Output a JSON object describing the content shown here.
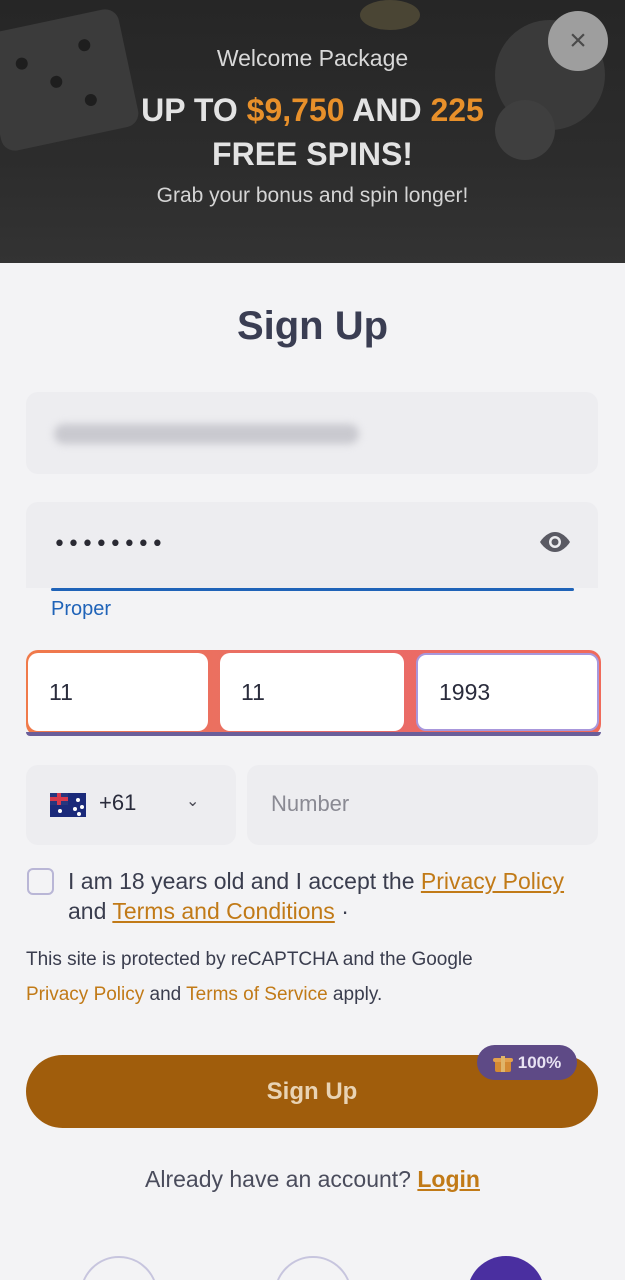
{
  "banner": {
    "welcome": "Welcome Package",
    "headline_prefix": "UP TO ",
    "headline_amount": "$9,750",
    "headline_and": " AND ",
    "headline_spins_count": "225",
    "headline_suffix": "FREE SPINS!",
    "subline": "Grab your bonus and spin longer!",
    "close_label": "×"
  },
  "form": {
    "title": "Sign Up",
    "password_value": "••••••••",
    "password_strength": "Proper",
    "dob": {
      "day": "11",
      "month": "11",
      "year": "1993"
    },
    "phone": {
      "country_code": "+61",
      "placeholder": "Number"
    },
    "consent": {
      "text_prefix": "I am 18 years old and I accept the ",
      "privacy_link": "Privacy Policy",
      "and": " and ",
      "terms_link": "Terms and Conditions",
      "suffix": " ·"
    },
    "recaptcha": {
      "text_prefix": "This site is protected by reCAPTCHA and the Google",
      "privacy_link": "Privacy Policy",
      "and": " and ",
      "terms_link": "Terms of Service",
      "suffix": " apply."
    },
    "submit_label": "Sign Up",
    "badge_label": "100%",
    "already_text": "Already have an account?",
    "login_label": "Login"
  },
  "colors": {
    "accent": "#e8902a",
    "link": "#c17a17",
    "button": "#a05d0c",
    "strength": "#1f63b8",
    "badge": "#5e4a86"
  },
  "icons": [
    "close-icon",
    "eye-icon",
    "australia-flag-icon",
    "chevron-down-icon",
    "gift-icon"
  ]
}
